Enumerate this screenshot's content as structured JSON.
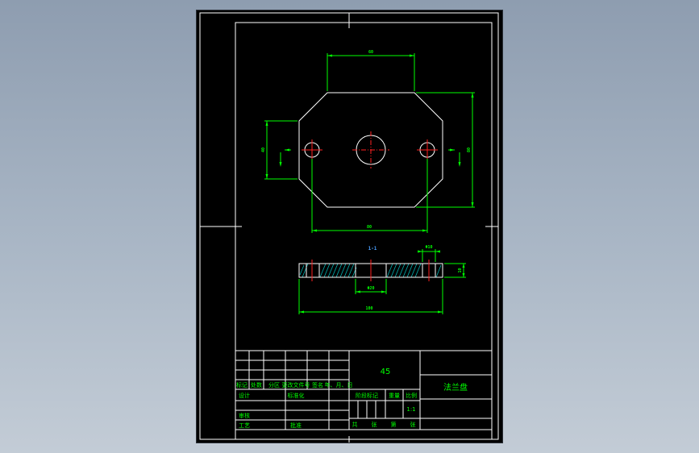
{
  "drawing": {
    "dimensions": {
      "top_width": "60",
      "left_height": "40",
      "right_height": "80",
      "bottom_width": "80",
      "hole_dia": "Φ10",
      "bore_dia": "Φ20",
      "overall_length": "100",
      "thickness": "10"
    },
    "section_label": "1-1"
  },
  "title_block": {
    "material": "45",
    "part_name": "法兰盘",
    "sig_labels": {
      "mark": "标记",
      "count": "处数",
      "zone": "分区",
      "doc_no": "更改文件号",
      "signature": "签名",
      "date": "年、月、日"
    },
    "roles": {
      "design": "设计",
      "standardize": "标准化",
      "review": "审核",
      "process": "工艺",
      "approve": "批准"
    },
    "stage_label": "阶段标记",
    "weight_label": "重量",
    "scale_label": "比例",
    "scale_value": "1:1",
    "sheets_total": "共",
    "sheets_unit1": "张",
    "sheets_no": "第",
    "sheets_unit2": "张"
  },
  "colors": {
    "sheet": "#000000",
    "outline": "#ffffff",
    "dimension": "#00ff00",
    "centerline": "#ff2020",
    "hatch": "#00c8c8",
    "section_label": "#4aa0ff"
  }
}
